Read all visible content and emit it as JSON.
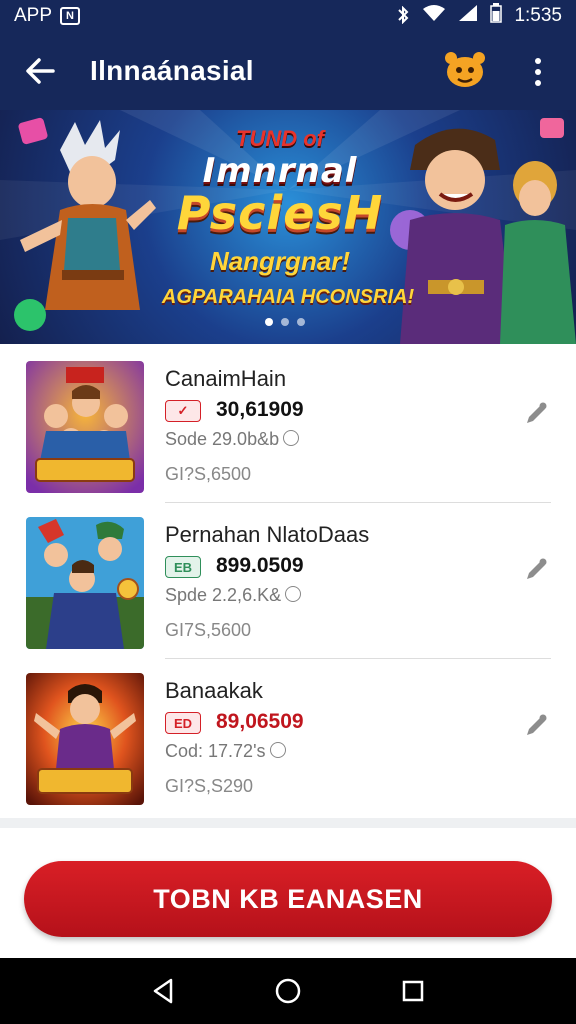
{
  "status_bar": {
    "app_label": "APP",
    "time": "1:535"
  },
  "app_bar": {
    "title": "Ilnnaánasial"
  },
  "banner": {
    "kicker": "TUND of",
    "title_line1": "Imnrnal",
    "title_line2": "PsciesH",
    "subtitle": "Nangrgnar!",
    "tagline": "AGPARAHAIA HCONSRIA!",
    "pages": 3,
    "active_page": 1
  },
  "items": [
    {
      "name": "CanaimHain",
      "badge": "✓",
      "badge_color": "#d42027",
      "amount": "30,61909",
      "amount_color": "#111111",
      "code": "Sode 29.0b&b",
      "price": "GI?S,6500"
    },
    {
      "name": "Pernahan NlatoDaas",
      "badge": "EB",
      "badge_color": "#2f8f5a",
      "amount": "899.0509",
      "amount_color": "#111111",
      "code": "Spde 2.2,6.K&",
      "price": "GI7S,5600"
    },
    {
      "name": "Banaakak",
      "badge": "ED",
      "badge_color": "#d42027",
      "amount": "89,06509",
      "amount_color": "#c0161e",
      "code": "Cod: 17.72's",
      "price": "GI?S,S290"
    }
  ],
  "cta_label": "TOBN KB EANASEN",
  "icons": {
    "back": "arrow-left-icon",
    "mascot": "mascot-icon",
    "more": "more-vert-icon",
    "edit": "edit-icon",
    "nav_back": "triangle-back-icon",
    "nav_home": "circle-home-icon",
    "nav_recents": "square-recents-icon"
  },
  "colors": {
    "app_bar": "#16285a",
    "cta": "#cc1a22",
    "nav": "#000000"
  }
}
